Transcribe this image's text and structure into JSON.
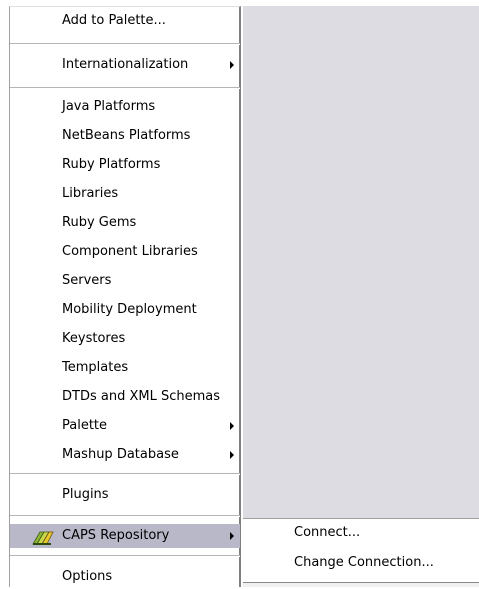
{
  "menu": {
    "items": [
      {
        "label": "Add to Palette...",
        "submenu": false
      },
      {
        "label": "Internationalization",
        "submenu": true
      },
      {
        "label": "Java Platforms",
        "submenu": false
      },
      {
        "label": "NetBeans Platforms",
        "submenu": false
      },
      {
        "label": "Ruby Platforms",
        "submenu": false
      },
      {
        "label": "Libraries",
        "submenu": false
      },
      {
        "label": "Ruby Gems",
        "submenu": false
      },
      {
        "label": "Component Libraries",
        "submenu": false
      },
      {
        "label": "Servers",
        "submenu": false
      },
      {
        "label": "Mobility Deployment",
        "submenu": false
      },
      {
        "label": "Keystores",
        "submenu": false
      },
      {
        "label": "Templates",
        "submenu": false
      },
      {
        "label": "DTDs and XML Schemas",
        "submenu": false
      },
      {
        "label": "Palette",
        "submenu": true
      },
      {
        "label": "Mashup Database",
        "submenu": true
      },
      {
        "label": "Plugins",
        "submenu": false
      },
      {
        "label": "CAPS Repository",
        "submenu": true,
        "selected": true,
        "icon": "caps-repository-icon"
      },
      {
        "label": "Options",
        "submenu": false
      }
    ]
  },
  "submenu": {
    "items": [
      {
        "label": "Connect..."
      },
      {
        "label": "Change Connection..."
      }
    ]
  },
  "colors": {
    "selected_bg": "#b8b8c8",
    "background_area": "#dcdce2",
    "menu_bg": "#ffffff"
  }
}
